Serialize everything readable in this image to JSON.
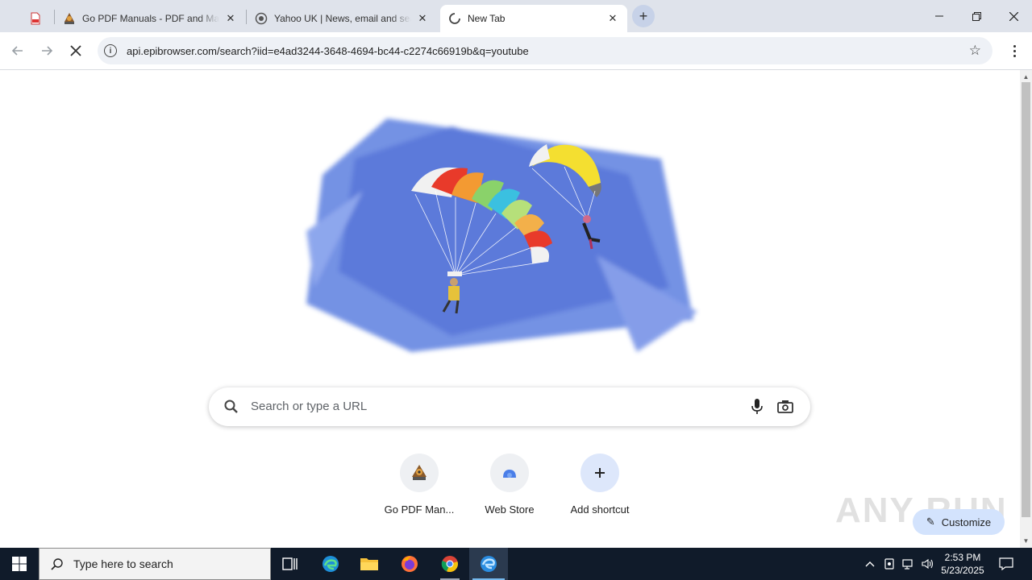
{
  "browser": {
    "tabs": [
      {
        "title": "",
        "icon": "pdf-icon"
      },
      {
        "title": "Go PDF Manuals - PDF and Manuals",
        "icon": "gopdf-favicon"
      },
      {
        "title": "Yahoo UK | News, email and search",
        "icon": "yahoo-favicon"
      },
      {
        "title": "New Tab",
        "icon": "loading-spinner-icon"
      }
    ],
    "url": "api.epibrowser.com/search?iid=e4ad3244-3648-4694-bc44-c2274c66919b&q=youtube"
  },
  "ntp": {
    "search_placeholder": "Search or type a URL",
    "shortcuts": [
      {
        "label": "Go PDF Man...",
        "icon": "gopdf-favicon"
      },
      {
        "label": "Web Store",
        "icon": "web-store-icon"
      },
      {
        "label": "Add shortcut",
        "icon": "plus-icon"
      }
    ],
    "customize_label": "Customize",
    "watermark": "ANY RUN"
  },
  "taskbar": {
    "search_placeholder": "Type here to search",
    "time": "2:53 PM",
    "date": "5/23/2025"
  }
}
